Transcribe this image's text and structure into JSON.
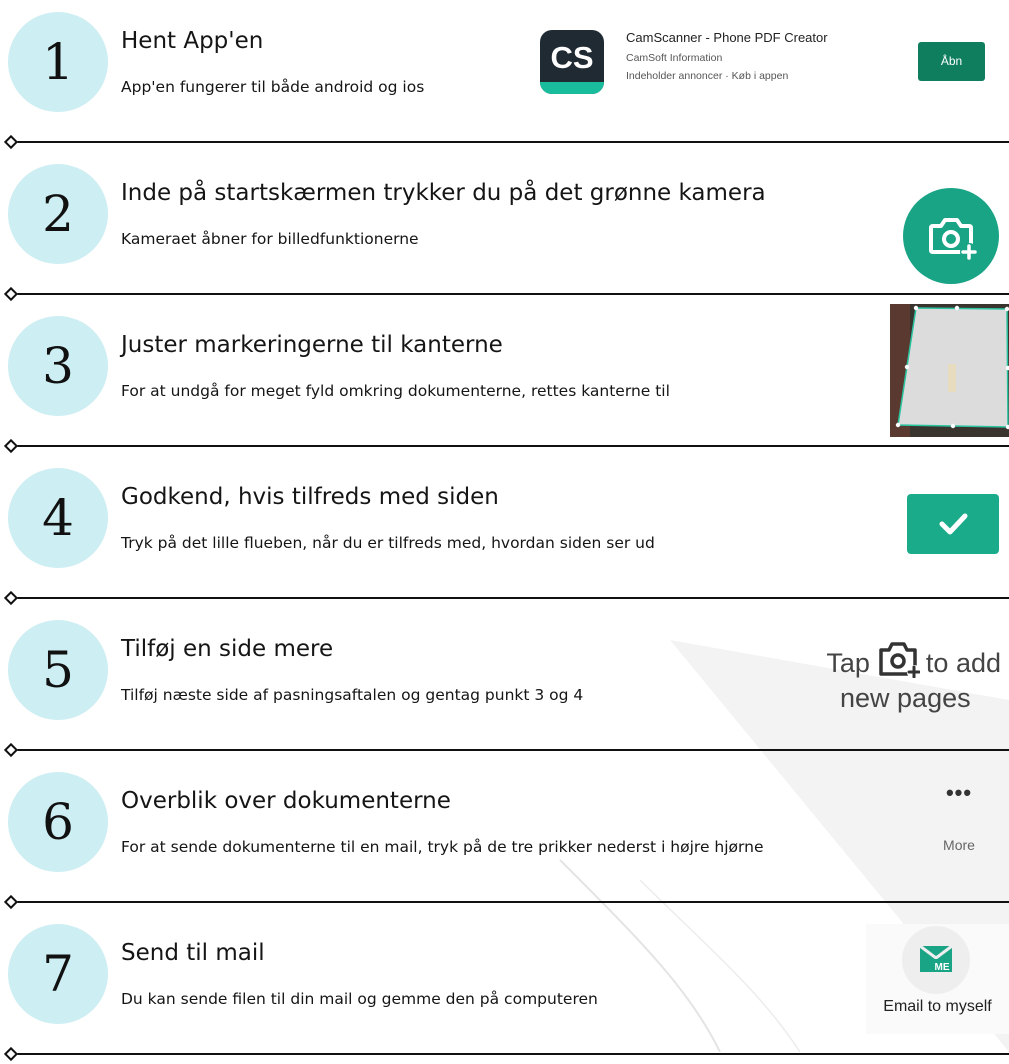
{
  "steps": [
    {
      "number": "1",
      "title": "Hent App'en",
      "description": "App'en fungerer til både android og ios"
    },
    {
      "number": "2",
      "title": "Inde på startskærmen trykker du på det grønne kamera",
      "description": "Kameraet åbner for billedfunktionerne"
    },
    {
      "number": "3",
      "title": "Juster markeringerne til kanterne",
      "description": "For at undgå for meget fyld omkring dokumenterne, rettes kanterne til"
    },
    {
      "number": "4",
      "title": "Godkend, hvis tilfreds med siden",
      "description": "Tryk på det lille flueben, når du er tilfreds med, hvordan siden ser ud"
    },
    {
      "number": "5",
      "title": "Tilføj en side mere",
      "description": "Tilføj næste side af pasningsaftalen og gentag punkt 3 og 4"
    },
    {
      "number": "6",
      "title": "Overblik over dokumenterne",
      "description": "For at sende dokumenterne til en mail, tryk på de tre prikker nederst i højre hjørne"
    },
    {
      "number": "7",
      "title": "Send til mail",
      "description": "Du kan sende filen til din mail og gemme den på computeren"
    }
  ],
  "app_listing": {
    "icon_text": "CS",
    "name": "CamScanner - Phone PDF Creator",
    "developer": "CamSoft Information",
    "meta": "Indeholder annoncer  ·  Køb i appen",
    "open_label": "Åbn"
  },
  "add_pages_hint": {
    "before": "Tap",
    "after": "to add",
    "line2": "new pages"
  },
  "more_menu": {
    "dots": "•••",
    "label": "More"
  },
  "email_action": {
    "icon_text": "ME",
    "label": "Email to myself"
  },
  "colors": {
    "circle": "#cdeef2",
    "teal": "#19a486",
    "app_button": "#0e7e5e",
    "check": "#1aab8b"
  },
  "icons": [
    "camera-plus-icon",
    "checkmark-icon",
    "more-dots-icon",
    "mail-me-icon"
  ]
}
